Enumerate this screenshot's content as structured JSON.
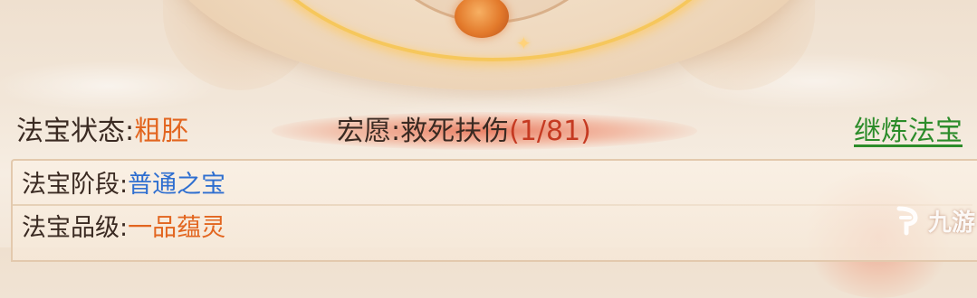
{
  "artifact_status": {
    "label": "法宝状态",
    "separator": ":",
    "value": "粗胚"
  },
  "wish": {
    "label": "宏愿",
    "separator": ":",
    "name": "救死扶伤",
    "progress_text": "(1/81)",
    "current": 1,
    "total": 81
  },
  "refine_link": {
    "label": "继炼法宝"
  },
  "info_rows": [
    {
      "label": "法宝阶段",
      "separator": ":",
      "value": "普通之宝"
    },
    {
      "label": "法宝品级",
      "separator": ":",
      "value": "一品蕴灵"
    }
  ],
  "watermark": {
    "text": "九游"
  },
  "colors": {
    "status_value": "#e2651f",
    "wish_count": "#c53a22",
    "link": "#2c8c2a",
    "stage_value": "#2f6fd0",
    "grade_value": "#e2651f",
    "label": "#3a2a22"
  }
}
